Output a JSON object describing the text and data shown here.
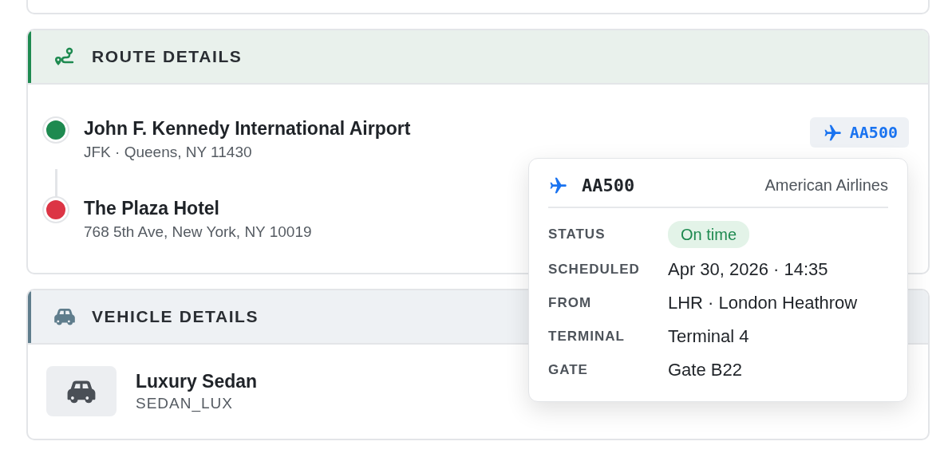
{
  "route": {
    "title": "ROUTE DETAILS",
    "stops": [
      {
        "name": "John F. Kennedy International Airport",
        "detail": "JFK · Queens, NY 11430",
        "color": "#1e8a50"
      },
      {
        "name": "The Plaza Hotel",
        "detail": "768 5th Ave, New York, NY 10019",
        "color": "#dc3545"
      }
    ],
    "flight_chip": "AA500"
  },
  "flight_popover": {
    "code": "AA500",
    "airline": "American Airlines",
    "rows": [
      {
        "label": "STATUS",
        "value": "On time",
        "kind": "badge"
      },
      {
        "label": "SCHEDULED",
        "value": "Apr 30, 2026 · 14:35",
        "kind": "text"
      },
      {
        "label": "FROM",
        "value": "LHR · London Heathrow",
        "kind": "text"
      },
      {
        "label": "TERMINAL",
        "value": "Terminal 4",
        "kind": "text"
      },
      {
        "label": "GATE",
        "value": "Gate B22",
        "kind": "text"
      }
    ]
  },
  "vehicle": {
    "title": "VEHICLE DETAILS",
    "name": "Luxury Sedan",
    "code": "SEDAN_LUX"
  }
}
